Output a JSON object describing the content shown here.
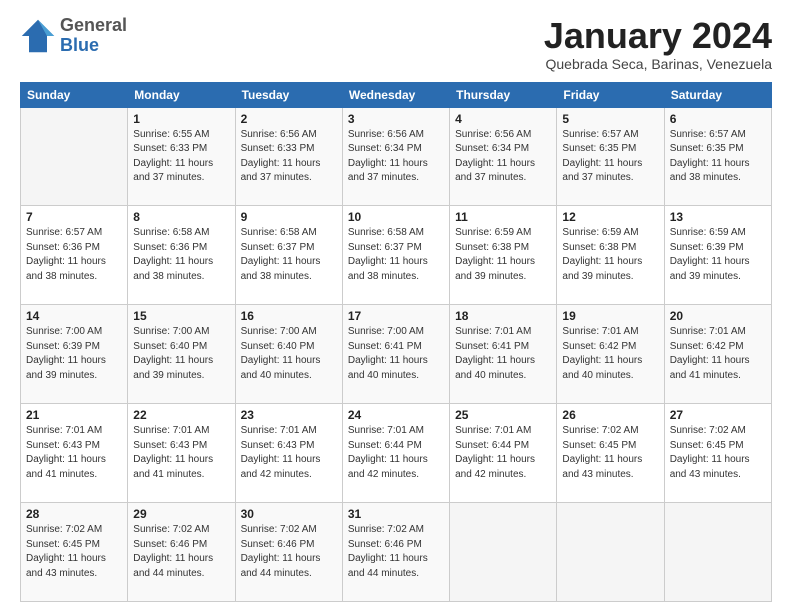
{
  "header": {
    "logo_general": "General",
    "logo_blue": "Blue",
    "month_title": "January 2024",
    "subtitle": "Quebrada Seca, Barinas, Venezuela"
  },
  "weekdays": [
    "Sunday",
    "Monday",
    "Tuesday",
    "Wednesday",
    "Thursday",
    "Friday",
    "Saturday"
  ],
  "weeks": [
    [
      {
        "day": "",
        "info": ""
      },
      {
        "day": "1",
        "info": "Sunrise: 6:55 AM\nSunset: 6:33 PM\nDaylight: 11 hours\nand 37 minutes."
      },
      {
        "day": "2",
        "info": "Sunrise: 6:56 AM\nSunset: 6:33 PM\nDaylight: 11 hours\nand 37 minutes."
      },
      {
        "day": "3",
        "info": "Sunrise: 6:56 AM\nSunset: 6:34 PM\nDaylight: 11 hours\nand 37 minutes."
      },
      {
        "day": "4",
        "info": "Sunrise: 6:56 AM\nSunset: 6:34 PM\nDaylight: 11 hours\nand 37 minutes."
      },
      {
        "day": "5",
        "info": "Sunrise: 6:57 AM\nSunset: 6:35 PM\nDaylight: 11 hours\nand 37 minutes."
      },
      {
        "day": "6",
        "info": "Sunrise: 6:57 AM\nSunset: 6:35 PM\nDaylight: 11 hours\nand 38 minutes."
      }
    ],
    [
      {
        "day": "7",
        "info": "Sunrise: 6:57 AM\nSunset: 6:36 PM\nDaylight: 11 hours\nand 38 minutes."
      },
      {
        "day": "8",
        "info": "Sunrise: 6:58 AM\nSunset: 6:36 PM\nDaylight: 11 hours\nand 38 minutes."
      },
      {
        "day": "9",
        "info": "Sunrise: 6:58 AM\nSunset: 6:37 PM\nDaylight: 11 hours\nand 38 minutes."
      },
      {
        "day": "10",
        "info": "Sunrise: 6:58 AM\nSunset: 6:37 PM\nDaylight: 11 hours\nand 38 minutes."
      },
      {
        "day": "11",
        "info": "Sunrise: 6:59 AM\nSunset: 6:38 PM\nDaylight: 11 hours\nand 39 minutes."
      },
      {
        "day": "12",
        "info": "Sunrise: 6:59 AM\nSunset: 6:38 PM\nDaylight: 11 hours\nand 39 minutes."
      },
      {
        "day": "13",
        "info": "Sunrise: 6:59 AM\nSunset: 6:39 PM\nDaylight: 11 hours\nand 39 minutes."
      }
    ],
    [
      {
        "day": "14",
        "info": "Sunrise: 7:00 AM\nSunset: 6:39 PM\nDaylight: 11 hours\nand 39 minutes."
      },
      {
        "day": "15",
        "info": "Sunrise: 7:00 AM\nSunset: 6:40 PM\nDaylight: 11 hours\nand 39 minutes."
      },
      {
        "day": "16",
        "info": "Sunrise: 7:00 AM\nSunset: 6:40 PM\nDaylight: 11 hours\nand 40 minutes."
      },
      {
        "day": "17",
        "info": "Sunrise: 7:00 AM\nSunset: 6:41 PM\nDaylight: 11 hours\nand 40 minutes."
      },
      {
        "day": "18",
        "info": "Sunrise: 7:01 AM\nSunset: 6:41 PM\nDaylight: 11 hours\nand 40 minutes."
      },
      {
        "day": "19",
        "info": "Sunrise: 7:01 AM\nSunset: 6:42 PM\nDaylight: 11 hours\nand 40 minutes."
      },
      {
        "day": "20",
        "info": "Sunrise: 7:01 AM\nSunset: 6:42 PM\nDaylight: 11 hours\nand 41 minutes."
      }
    ],
    [
      {
        "day": "21",
        "info": "Sunrise: 7:01 AM\nSunset: 6:43 PM\nDaylight: 11 hours\nand 41 minutes."
      },
      {
        "day": "22",
        "info": "Sunrise: 7:01 AM\nSunset: 6:43 PM\nDaylight: 11 hours\nand 41 minutes."
      },
      {
        "day": "23",
        "info": "Sunrise: 7:01 AM\nSunset: 6:43 PM\nDaylight: 11 hours\nand 42 minutes."
      },
      {
        "day": "24",
        "info": "Sunrise: 7:01 AM\nSunset: 6:44 PM\nDaylight: 11 hours\nand 42 minutes."
      },
      {
        "day": "25",
        "info": "Sunrise: 7:01 AM\nSunset: 6:44 PM\nDaylight: 11 hours\nand 42 minutes."
      },
      {
        "day": "26",
        "info": "Sunrise: 7:02 AM\nSunset: 6:45 PM\nDaylight: 11 hours\nand 43 minutes."
      },
      {
        "day": "27",
        "info": "Sunrise: 7:02 AM\nSunset: 6:45 PM\nDaylight: 11 hours\nand 43 minutes."
      }
    ],
    [
      {
        "day": "28",
        "info": "Sunrise: 7:02 AM\nSunset: 6:45 PM\nDaylight: 11 hours\nand 43 minutes."
      },
      {
        "day": "29",
        "info": "Sunrise: 7:02 AM\nSunset: 6:46 PM\nDaylight: 11 hours\nand 44 minutes."
      },
      {
        "day": "30",
        "info": "Sunrise: 7:02 AM\nSunset: 6:46 PM\nDaylight: 11 hours\nand 44 minutes."
      },
      {
        "day": "31",
        "info": "Sunrise: 7:02 AM\nSunset: 6:46 PM\nDaylight: 11 hours\nand 44 minutes."
      },
      {
        "day": "",
        "info": ""
      },
      {
        "day": "",
        "info": ""
      },
      {
        "day": "",
        "info": ""
      }
    ]
  ]
}
